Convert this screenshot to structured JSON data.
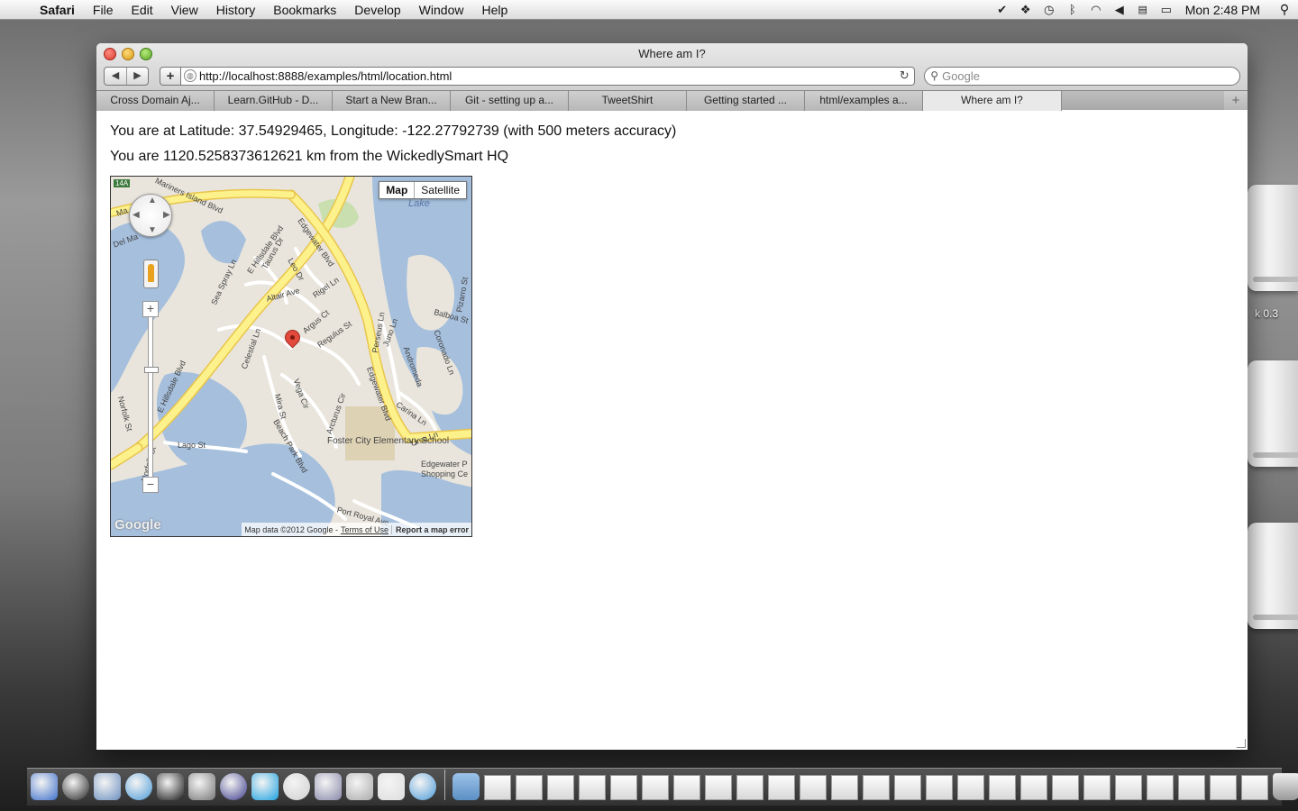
{
  "menubar": {
    "app_name": "Safari",
    "items": [
      "File",
      "Edit",
      "View",
      "History",
      "Bookmarks",
      "Develop",
      "Window",
      "Help"
    ],
    "clock": "Mon 2:48 PM"
  },
  "desktop": {
    "drive_label": "k 0.3"
  },
  "window": {
    "title": "Where am I?",
    "address_url": "http://localhost:8888/examples/html/location.html",
    "search_placeholder": "Google",
    "tabs": [
      "Cross Domain Aj...",
      "Learn.GitHub - D...",
      "Start a New Bran...",
      "Git - setting up a...",
      "TweetShirt",
      "Getting started ...",
      "html/examples a...",
      "Where am I?"
    ],
    "active_tab_index": 7
  },
  "page": {
    "location_text": "You are at Latitude: 37.54929465, Longitude: -122.27792739 (with 500 meters accuracy)",
    "distance_text": "You are 1120.5258373612621 km from the WickedlySmart HQ"
  },
  "map": {
    "type_buttons": [
      "Map",
      "Satellite"
    ],
    "active_type": "Map",
    "zoom_level_fraction": 0.3,
    "labels": {
      "mariners_island_blvd": "Mariners Island Blvd",
      "e_hillsdale_blvd_top": "E Hillsdale Blvd",
      "e_hillsdale_blvd_left": "E Hillsdale Blvd",
      "edgewater_blvd_top": "Edgewater Blvd",
      "edgewater_blvd_right": "Edgewater Blvd",
      "lake": "Lake",
      "taurus_dr": "Taurus Dr",
      "leo_dr": "Leo Dr",
      "sea_spray_ln": "Sea Spray Ln",
      "altair_ave": "Altair Ave",
      "rigel_ln": "Rigel Ln",
      "argus_ct": "Argus Ct",
      "regulus_st": "Regulus St",
      "celestial_ln": "Celestial Ln",
      "perseus_ln": "Perseus Ln",
      "juno_ln": "Juno Ln",
      "andromeda": "Andromeda",
      "balboa_st": "Balboa St",
      "pizarro_st": "Pizarro St",
      "coronado_ln": "Coronado Ln",
      "vega_cir": "Vega Cir",
      "mira_st": "Mira St",
      "arcturus_cir": "Arcturus Cir",
      "carina_ln": "Carina Ln",
      "ursa_ln": "Ursa Ln",
      "beach_park_blvd": "Beach Park Blvd",
      "lago_st": "Lago St",
      "norfolk_st_left": "Norfolk St",
      "norfolk_st_bottom": "Norfolk St",
      "school": "Foster City Elementary School",
      "shopping": "Edgewater P Shopping Ce",
      "port_royal_ave": "Port Royal Ave",
      "delma": "Del Ma",
      "ma": "Ma",
      "shield": "14A"
    },
    "logo": "Google",
    "footer_data": "Map data ©2012 Google -",
    "footer_terms": "Terms of Use",
    "footer_report": "Report a map error",
    "colors": {
      "land": "#e9e5dc",
      "water": "#a5bfdd",
      "major_road": "#fdf18c",
      "major_road_edge": "#e9c54a",
      "minor_road": "#ffffff",
      "park": "#c9dfaf",
      "school_area": "#ded2b5",
      "marker": "#e24a3d"
    }
  },
  "dock": {
    "app_icons": [
      "finder-icon",
      "dashboard-icon",
      "preview-icon",
      "safari-icon",
      "terminal-icon",
      "github-icon",
      "globe-icon",
      "skype-icon",
      "chrome-icon",
      "photos-icon",
      "script-icon",
      "textedit-icon",
      "safari-icon"
    ],
    "document_count": 25
  }
}
